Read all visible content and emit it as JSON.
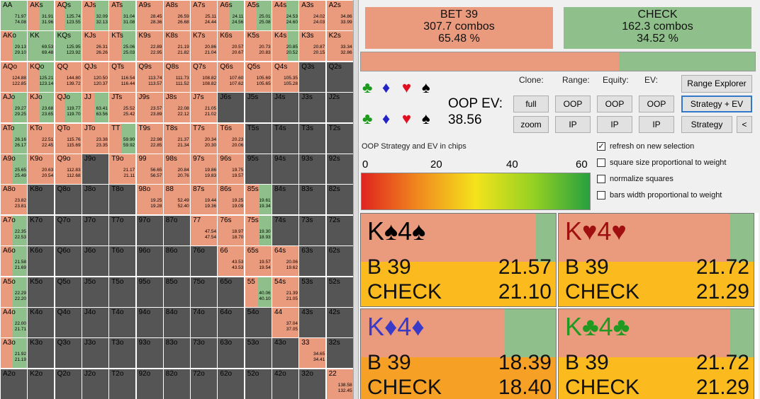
{
  "grid": {
    "colors": {
      "bet": "#ea9a7d",
      "check": "#8fbf8a",
      "empty": "#555555"
    },
    "cells": [
      {
        "label": "AA",
        "bet": 0,
        "v1": "71.97",
        "v2": "74.08"
      },
      {
        "label": "AKs",
        "bet": 0.45,
        "v1": "31.91",
        "v2": "31.96"
      },
      {
        "label": "AQs",
        "bet": 0.35,
        "v1": "125.74",
        "v2": "123.55"
      },
      {
        "label": "AJs",
        "bet": 0.45,
        "v1": "32.09",
        "v2": "32.13"
      },
      {
        "label": "ATs",
        "bet": 0.45,
        "v1": "31.04",
        "v2": "31.08"
      },
      {
        "label": "A9s",
        "bet": 1,
        "v1": "28.45",
        "v2": "28.36"
      },
      {
        "label": "A8s",
        "bet": 1,
        "v1": "26.59",
        "v2": "26.68"
      },
      {
        "label": "A7s",
        "bet": 1,
        "v1": "25.11",
        "v2": "24.44"
      },
      {
        "label": "A6s",
        "bet": 0.45,
        "v1": "24.11",
        "v2": "24.56"
      },
      {
        "label": "A5s",
        "bet": 0.45,
        "v1": "25.01",
        "v2": "25.08"
      },
      {
        "label": "A4s",
        "bet": 0.55,
        "v1": "24.53",
        "v2": "24.60"
      },
      {
        "label": "A3s",
        "bet": 1,
        "v1": "24.02",
        "v2": "24.03"
      },
      {
        "label": "A2s",
        "bet": 1,
        "v1": "34.86",
        "v2": "33.99"
      },
      {
        "label": "AKo",
        "bet": 0.45,
        "v1": "29.13",
        "v2": "29.10"
      },
      {
        "label": "KK",
        "bet": 0,
        "v1": "69.53",
        "v2": "69.48"
      },
      {
        "label": "KQs",
        "bet": 0,
        "v1": "125.95",
        "v2": "123.92"
      },
      {
        "label": "KJs",
        "bet": 1,
        "v1": "26.31",
        "v2": "26.26"
      },
      {
        "label": "KTs",
        "bet": 0.45,
        "v1": "25.06",
        "v2": "25.03"
      },
      {
        "label": "K9s",
        "bet": 1,
        "v1": "22.89",
        "v2": "22.95"
      },
      {
        "label": "K8s",
        "bet": 1,
        "v1": "21.19",
        "v2": "21.82"
      },
      {
        "label": "K7s",
        "bet": 1,
        "v1": "20.86",
        "v2": "21.04"
      },
      {
        "label": "K6s",
        "bet": 1,
        "v1": "20.57",
        "v2": "20.67"
      },
      {
        "label": "K5s",
        "bet": 1,
        "v1": "20.73",
        "v2": "20.83"
      },
      {
        "label": "K4s",
        "bet": 0.6,
        "v1": "20.85",
        "v2": "20.52"
      },
      {
        "label": "K3s",
        "bet": 1,
        "v1": "20.87",
        "v2": "20.15"
      },
      {
        "label": "K2s",
        "bet": 1,
        "v1": "33.34",
        "v2": "32.86"
      },
      {
        "label": "AQo",
        "bet": 1,
        "v1": "124.88",
        "v2": "122.85"
      },
      {
        "label": "KQo",
        "bet": 0.45,
        "v1": "125.21",
        "v2": "123.14"
      },
      {
        "label": "QQ",
        "bet": 1,
        "v1": "144.80",
        "v2": "139.72"
      },
      {
        "label": "QJs",
        "bet": 1,
        "v1": "120.50",
        "v2": "120.37"
      },
      {
        "label": "QTs",
        "bet": 1,
        "v1": "116.54",
        "v2": "116.44"
      },
      {
        "label": "Q9s",
        "bet": 1,
        "v1": "113.74",
        "v2": "113.57"
      },
      {
        "label": "Q8s",
        "bet": 1,
        "v1": "111.73",
        "v2": "111.52"
      },
      {
        "label": "Q7s",
        "bet": 1,
        "v1": "108.82",
        "v2": "108.82"
      },
      {
        "label": "Q6s",
        "bet": 1,
        "v1": "107.60",
        "v2": "107.62"
      },
      {
        "label": "Q5s",
        "bet": 1,
        "v1": "105.69",
        "v2": "105.65"
      },
      {
        "label": "Q4s",
        "bet": 1,
        "v1": "105.35",
        "v2": "105.28"
      },
      {
        "label": "Q3s",
        "bet": -1,
        "v1": "",
        "v2": ""
      },
      {
        "label": "Q2s",
        "bet": -1,
        "v1": "",
        "v2": ""
      },
      {
        "label": "AJo",
        "bet": 0.45,
        "v1": "29.27",
        "v2": "29.25"
      },
      {
        "label": "KJo",
        "bet": 0.45,
        "v1": "23.68",
        "v2": "23.65"
      },
      {
        "label": "QJo",
        "bet": 0.35,
        "v1": "119.77",
        "v2": "119.70"
      },
      {
        "label": "JJ",
        "bet": 0.45,
        "v1": "63.41",
        "v2": "63.56"
      },
      {
        "label": "JTs",
        "bet": 1,
        "v1": "25.52",
        "v2": "25.42"
      },
      {
        "label": "J9s",
        "bet": 1,
        "v1": "23.57",
        "v2": "23.89"
      },
      {
        "label": "J8s",
        "bet": 1,
        "v1": "22.08",
        "v2": "22.12"
      },
      {
        "label": "J7s",
        "bet": 1,
        "v1": "21.05",
        "v2": "21.02"
      },
      {
        "label": "J6s",
        "bet": -1,
        "v1": "",
        "v2": ""
      },
      {
        "label": "J5s",
        "bet": -1,
        "v1": "",
        "v2": ""
      },
      {
        "label": "J4s",
        "bet": -1,
        "v1": "",
        "v2": ""
      },
      {
        "label": "J3s",
        "bet": -1,
        "v1": "",
        "v2": ""
      },
      {
        "label": "J2s",
        "bet": -1,
        "v1": "",
        "v2": ""
      },
      {
        "label": "ATo",
        "bet": 0.45,
        "v1": "26.16",
        "v2": "26.17"
      },
      {
        "label": "KTo",
        "bet": 1,
        "v1": "22.51",
        "v2": "22.45"
      },
      {
        "label": "QTo",
        "bet": 1,
        "v1": "115.76",
        "v2": "115.69"
      },
      {
        "label": "JTo",
        "bet": 1,
        "v1": "23.38",
        "v2": "23.35"
      },
      {
        "label": "TT",
        "bet": 0.45,
        "v1": "59.90",
        "v2": "59.92"
      },
      {
        "label": "T9s",
        "bet": 1,
        "v1": "22.98",
        "v2": "22.85"
      },
      {
        "label": "T8s",
        "bet": 1,
        "v1": "21.37",
        "v2": "21.34"
      },
      {
        "label": "T7s",
        "bet": 1,
        "v1": "20.34",
        "v2": "20.30"
      },
      {
        "label": "T6s",
        "bet": 1,
        "v1": "20.23",
        "v2": "20.06"
      },
      {
        "label": "T5s",
        "bet": -1,
        "v1": "",
        "v2": ""
      },
      {
        "label": "T4s",
        "bet": -1,
        "v1": "",
        "v2": ""
      },
      {
        "label": "T3s",
        "bet": -1,
        "v1": "",
        "v2": ""
      },
      {
        "label": "T2s",
        "bet": -1,
        "v1": "",
        "v2": ""
      },
      {
        "label": "A9o",
        "bet": 0.45,
        "v1": "25.65",
        "v2": "25.49"
      },
      {
        "label": "K9o",
        "bet": 1,
        "v1": "20.63",
        "v2": "20.54"
      },
      {
        "label": "Q9o",
        "bet": 1,
        "v1": "112.83",
        "v2": "112.68"
      },
      {
        "label": "J9o",
        "bet": -1,
        "v1": "",
        "v2": ""
      },
      {
        "label": "T9o",
        "bet": 1,
        "v1": "21.17",
        "v2": "21.11"
      },
      {
        "label": "99",
        "bet": 1,
        "v1": "56.65",
        "v2": "56.57"
      },
      {
        "label": "98s",
        "bet": 1,
        "v1": "20.84",
        "v2": "20.76"
      },
      {
        "label": "97s",
        "bet": 1,
        "v1": "19.86",
        "v2": "19.83"
      },
      {
        "label": "96s",
        "bet": 1,
        "v1": "19.75",
        "v2": "19.57"
      },
      {
        "label": "95s",
        "bet": -1,
        "v1": "",
        "v2": ""
      },
      {
        "label": "94s",
        "bet": -1,
        "v1": "",
        "v2": ""
      },
      {
        "label": "93s",
        "bet": -1,
        "v1": "",
        "v2": ""
      },
      {
        "label": "92s",
        "bet": -1,
        "v1": "",
        "v2": ""
      },
      {
        "label": "A8o",
        "bet": 1,
        "v1": "23.82",
        "v2": "23.81"
      },
      {
        "label": "K8o",
        "bet": -1,
        "v1": "",
        "v2": ""
      },
      {
        "label": "Q8o",
        "bet": -1,
        "v1": "",
        "v2": ""
      },
      {
        "label": "J8o",
        "bet": -1,
        "v1": "",
        "v2": ""
      },
      {
        "label": "T8o",
        "bet": -1,
        "v1": "",
        "v2": ""
      },
      {
        "label": "98o",
        "bet": 1,
        "v1": "19.25",
        "v2": "19.28"
      },
      {
        "label": "88",
        "bet": 1,
        "v1": "52.49",
        "v2": "52.40"
      },
      {
        "label": "87s",
        "bet": 1,
        "v1": "19.44",
        "v2": "19.36"
      },
      {
        "label": "86s",
        "bet": 1,
        "v1": "19.25",
        "v2": "19.09"
      },
      {
        "label": "85s",
        "bet": 0.55,
        "v1": "19.61",
        "v2": "19.34"
      },
      {
        "label": "84s",
        "bet": -1,
        "v1": "",
        "v2": ""
      },
      {
        "label": "83s",
        "bet": -1,
        "v1": "",
        "v2": ""
      },
      {
        "label": "82s",
        "bet": -1,
        "v1": "",
        "v2": ""
      },
      {
        "label": "A7o",
        "bet": 0.45,
        "v1": "22.35",
        "v2": "22.53"
      },
      {
        "label": "K7o",
        "bet": -1,
        "v1": "",
        "v2": ""
      },
      {
        "label": "Q7o",
        "bet": -1,
        "v1": "",
        "v2": ""
      },
      {
        "label": "J7o",
        "bet": -1,
        "v1": "",
        "v2": ""
      },
      {
        "label": "T7o",
        "bet": -1,
        "v1": "",
        "v2": ""
      },
      {
        "label": "97o",
        "bet": -1,
        "v1": "",
        "v2": ""
      },
      {
        "label": "87o",
        "bet": -1,
        "v1": "",
        "v2": ""
      },
      {
        "label": "77",
        "bet": 1,
        "v1": "47.54",
        "v2": "47.54"
      },
      {
        "label": "76s",
        "bet": 1,
        "v1": "18.97",
        "v2": "18.70"
      },
      {
        "label": "75s",
        "bet": 0.55,
        "v1": "19.30",
        "v2": "18.93"
      },
      {
        "label": "74s",
        "bet": -1,
        "v1": "",
        "v2": ""
      },
      {
        "label": "73s",
        "bet": -1,
        "v1": "",
        "v2": ""
      },
      {
        "label": "72s",
        "bet": -1,
        "v1": "",
        "v2": ""
      },
      {
        "label": "A6o",
        "bet": 0.45,
        "v1": "21.58",
        "v2": "21.69"
      },
      {
        "label": "K6o",
        "bet": -1,
        "v1": "",
        "v2": ""
      },
      {
        "label": "Q6o",
        "bet": -1,
        "v1": "",
        "v2": ""
      },
      {
        "label": "J6o",
        "bet": -1,
        "v1": "",
        "v2": ""
      },
      {
        "label": "T6o",
        "bet": -1,
        "v1": "",
        "v2": ""
      },
      {
        "label": "96o",
        "bet": -1,
        "v1": "",
        "v2": ""
      },
      {
        "label": "86o",
        "bet": -1,
        "v1": "",
        "v2": ""
      },
      {
        "label": "76o",
        "bet": -1,
        "v1": "",
        "v2": ""
      },
      {
        "label": "66",
        "bet": 1,
        "v1": "43.53",
        "v2": "43.53"
      },
      {
        "label": "65s",
        "bet": 1,
        "v1": "19.57",
        "v2": "19.54"
      },
      {
        "label": "64s",
        "bet": 1,
        "v1": "20.06",
        "v2": "19.62"
      },
      {
        "label": "63s",
        "bet": -1,
        "v1": "",
        "v2": ""
      },
      {
        "label": "62s",
        "bet": -1,
        "v1": "",
        "v2": ""
      },
      {
        "label": "A5o",
        "bet": 0.45,
        "v1": "22.29",
        "v2": "22.20"
      },
      {
        "label": "K5o",
        "bet": -1,
        "v1": "",
        "v2": ""
      },
      {
        "label": "Q5o",
        "bet": -1,
        "v1": "",
        "v2": ""
      },
      {
        "label": "J5o",
        "bet": -1,
        "v1": "",
        "v2": ""
      },
      {
        "label": "T5o",
        "bet": -1,
        "v1": "",
        "v2": ""
      },
      {
        "label": "95o",
        "bet": -1,
        "v1": "",
        "v2": ""
      },
      {
        "label": "85o",
        "bet": -1,
        "v1": "",
        "v2": ""
      },
      {
        "label": "75o",
        "bet": -1,
        "v1": "",
        "v2": ""
      },
      {
        "label": "65o",
        "bet": -1,
        "v1": "",
        "v2": ""
      },
      {
        "label": "55",
        "bet": 0.5,
        "v1": "40.06",
        "v2": "40.10"
      },
      {
        "label": "54s",
        "bet": 1,
        "v1": "21.39",
        "v2": "21.05"
      },
      {
        "label": "53s",
        "bet": -1,
        "v1": "",
        "v2": ""
      },
      {
        "label": "52s",
        "bet": -1,
        "v1": "",
        "v2": ""
      },
      {
        "label": "A4o",
        "bet": 0.45,
        "v1": "22.00",
        "v2": "21.71"
      },
      {
        "label": "K4o",
        "bet": -1,
        "v1": "",
        "v2": ""
      },
      {
        "label": "Q4o",
        "bet": -1,
        "v1": "",
        "v2": ""
      },
      {
        "label": "J4o",
        "bet": -1,
        "v1": "",
        "v2": ""
      },
      {
        "label": "T4o",
        "bet": -1,
        "v1": "",
        "v2": ""
      },
      {
        "label": "94o",
        "bet": -1,
        "v1": "",
        "v2": ""
      },
      {
        "label": "84o",
        "bet": -1,
        "v1": "",
        "v2": ""
      },
      {
        "label": "74o",
        "bet": -1,
        "v1": "",
        "v2": ""
      },
      {
        "label": "64o",
        "bet": -1,
        "v1": "",
        "v2": ""
      },
      {
        "label": "54o",
        "bet": -1,
        "v1": "",
        "v2": ""
      },
      {
        "label": "44",
        "bet": 1,
        "v1": "37.04",
        "v2": "37.05"
      },
      {
        "label": "43s",
        "bet": -1,
        "v1": "",
        "v2": ""
      },
      {
        "label": "42s",
        "bet": -1,
        "v1": "",
        "v2": ""
      },
      {
        "label": "A3o",
        "bet": 0.45,
        "v1": "21.92",
        "v2": "21.19"
      },
      {
        "label": "K3o",
        "bet": -1,
        "v1": "",
        "v2": ""
      },
      {
        "label": "Q3o",
        "bet": -1,
        "v1": "",
        "v2": ""
      },
      {
        "label": "J3o",
        "bet": -1,
        "v1": "",
        "v2": ""
      },
      {
        "label": "T3o",
        "bet": -1,
        "v1": "",
        "v2": ""
      },
      {
        "label": "93o",
        "bet": -1,
        "v1": "",
        "v2": ""
      },
      {
        "label": "83o",
        "bet": -1,
        "v1": "",
        "v2": ""
      },
      {
        "label": "73o",
        "bet": -1,
        "v1": "",
        "v2": ""
      },
      {
        "label": "63o",
        "bet": -1,
        "v1": "",
        "v2": ""
      },
      {
        "label": "53o",
        "bet": -1,
        "v1": "",
        "v2": ""
      },
      {
        "label": "43o",
        "bet": -1,
        "v1": "",
        "v2": ""
      },
      {
        "label": "33",
        "bet": 1,
        "v1": "34.65",
        "v2": "34.41"
      },
      {
        "label": "32s",
        "bet": -1,
        "v1": "",
        "v2": ""
      },
      {
        "label": "A2o",
        "bet": -1,
        "v1": "",
        "v2": ""
      },
      {
        "label": "K2o",
        "bet": -1,
        "v1": "",
        "v2": ""
      },
      {
        "label": "Q2o",
        "bet": -1,
        "v1": "",
        "v2": ""
      },
      {
        "label": "J2o",
        "bet": -1,
        "v1": "",
        "v2": ""
      },
      {
        "label": "T2o",
        "bet": -1,
        "v1": "",
        "v2": ""
      },
      {
        "label": "92o",
        "bet": -1,
        "v1": "",
        "v2": ""
      },
      {
        "label": "82o",
        "bet": -1,
        "v1": "",
        "v2": ""
      },
      {
        "label": "72o",
        "bet": -1,
        "v1": "",
        "v2": ""
      },
      {
        "label": "62o",
        "bet": -1,
        "v1": "",
        "v2": ""
      },
      {
        "label": "52o",
        "bet": -1,
        "v1": "",
        "v2": ""
      },
      {
        "label": "42o",
        "bet": -1,
        "v1": "",
        "v2": ""
      },
      {
        "label": "32o",
        "bet": -1,
        "v1": "",
        "v2": ""
      },
      {
        "label": "22",
        "bet": 1,
        "v1": "138.58",
        "v2": "132.45"
      }
    ]
  },
  "actions": {
    "bet": {
      "title": "BET 39",
      "combos": "307.7 combos",
      "pct": "65.48 %",
      "color": "#ea9a7d"
    },
    "check": {
      "title": "CHECK",
      "combos": "162.3 combos",
      "pct": "34.52 %",
      "color": "#8fbf8a"
    },
    "bet_fraction": 0.6548
  },
  "controls": {
    "clone_label": "Clone:",
    "range_label": "Range:",
    "equity_label": "Equity:",
    "ev_label": "EV:",
    "full": "full",
    "zoom": "zoom",
    "range_oop": "OOP",
    "range_ip": "IP",
    "equity_oop": "OOP",
    "equity_ip": "IP",
    "ev_oop": "OOP",
    "ev_ip": "IP",
    "range_explorer": "Range Explorer",
    "strategy_ev": "Strategy + EV",
    "strategy": "Strategy",
    "back": "<"
  },
  "suits": {
    "club": "♣",
    "diamond": "♦",
    "heart": "♥",
    "spade": "♠"
  },
  "oop_ev": {
    "label": "OOP EV:",
    "value": "38.56"
  },
  "legend": {
    "title": "OOP Strategy and EV in chips",
    "ticks": [
      "0",
      "20",
      "40",
      "60"
    ]
  },
  "options": [
    {
      "label": "refresh on new selection",
      "checked": true
    },
    {
      "label": "square size proportional to weight",
      "checked": false
    },
    {
      "label": "normalize squares",
      "checked": false
    },
    {
      "label": "bars width proportional to weight",
      "checked": false
    }
  ],
  "combos": [
    {
      "hand": "K♠4♠",
      "color": "#000000",
      "bet_frac": 0.9,
      "b_label": "B 39",
      "b_val": "21.57",
      "c_label": "CHECK",
      "c_val": "21.10",
      "bot_color": "#fbbb1f"
    },
    {
      "hand": "K♥4♥",
      "color": "#a01010",
      "bet_frac": 0.88,
      "b_label": "B 39",
      "b_val": "21.72",
      "c_label": "CHECK",
      "c_val": "21.29",
      "bot_color": "#fbbb1f"
    },
    {
      "hand": "K♦4♦",
      "color": "#3a3ac8",
      "bet_frac": 0.74,
      "b_label": "B 39",
      "b_val": "18.39",
      "c_label": "CHECK",
      "c_val": "18.40",
      "bot_color": "#f7a026"
    },
    {
      "hand": "K♣4♣",
      "color": "#229a22",
      "bet_frac": 0.88,
      "b_label": "B 39",
      "b_val": "21.72",
      "c_label": "CHECK",
      "c_val": "21.29",
      "bot_color": "#fbbb1f"
    }
  ]
}
